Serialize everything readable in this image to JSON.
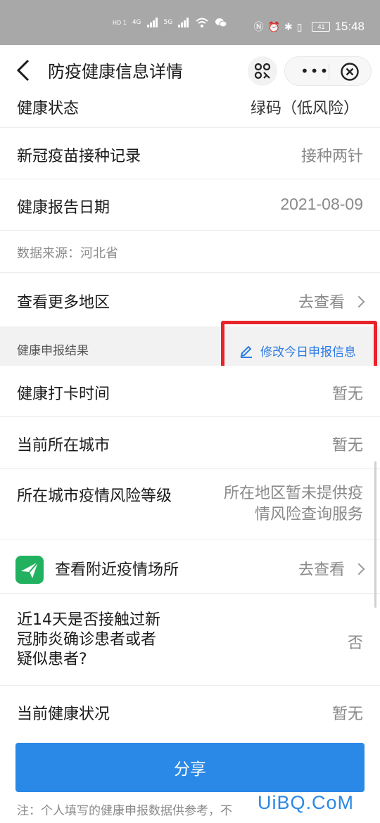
{
  "status_bar": {
    "time": "15:48",
    "battery": "41",
    "signal_4g": "4G",
    "signal_5g": "5G",
    "hd1": "HD 1",
    "hd2": "HD 2"
  },
  "nav": {
    "title": "防疫健康信息详情"
  },
  "rows": {
    "health_status": {
      "label": "健康状态",
      "value": "绿码（低风险）"
    },
    "vaccine": {
      "label": "新冠疫苗接种记录",
      "value": "接种两针"
    },
    "report_date": {
      "label": "健康报告日期",
      "value": "2021-08-09"
    },
    "data_source": "数据来源：河北省",
    "more_regions": {
      "label": "查看更多地区",
      "value": "去查看"
    }
  },
  "section": {
    "title": "健康申报结果",
    "edit_link": "修改今日申报信息"
  },
  "declaration": {
    "checkin_time": {
      "label": "健康打卡时间",
      "value": "暂无"
    },
    "current_city": {
      "label": "当前所在城市",
      "value": "暂无"
    },
    "risk_level": {
      "label": "所在城市疫情风险等级",
      "value_line1": "所在地区暂未提供疫",
      "value_line2": "情风险查询服务"
    },
    "nearby": {
      "label": "查看附近疫情场所",
      "value": "去查看"
    },
    "contact_14d": {
      "label_line1": "近14天是否接触过新",
      "label_line2": "冠肺炎确诊患者或者",
      "label_line3": "疑似患者?",
      "value": "否"
    },
    "current_health": {
      "label": "当前健康状况",
      "value": "暂无"
    }
  },
  "share_button": "分享",
  "footnote": "注：个人填写的健康申报数据供参考，不",
  "watermark": "UiBQ.CoM",
  "colors": {
    "accent": "#2a88e6",
    "highlight_box": "#e8232a",
    "nearby_icon": "#22b25f"
  }
}
